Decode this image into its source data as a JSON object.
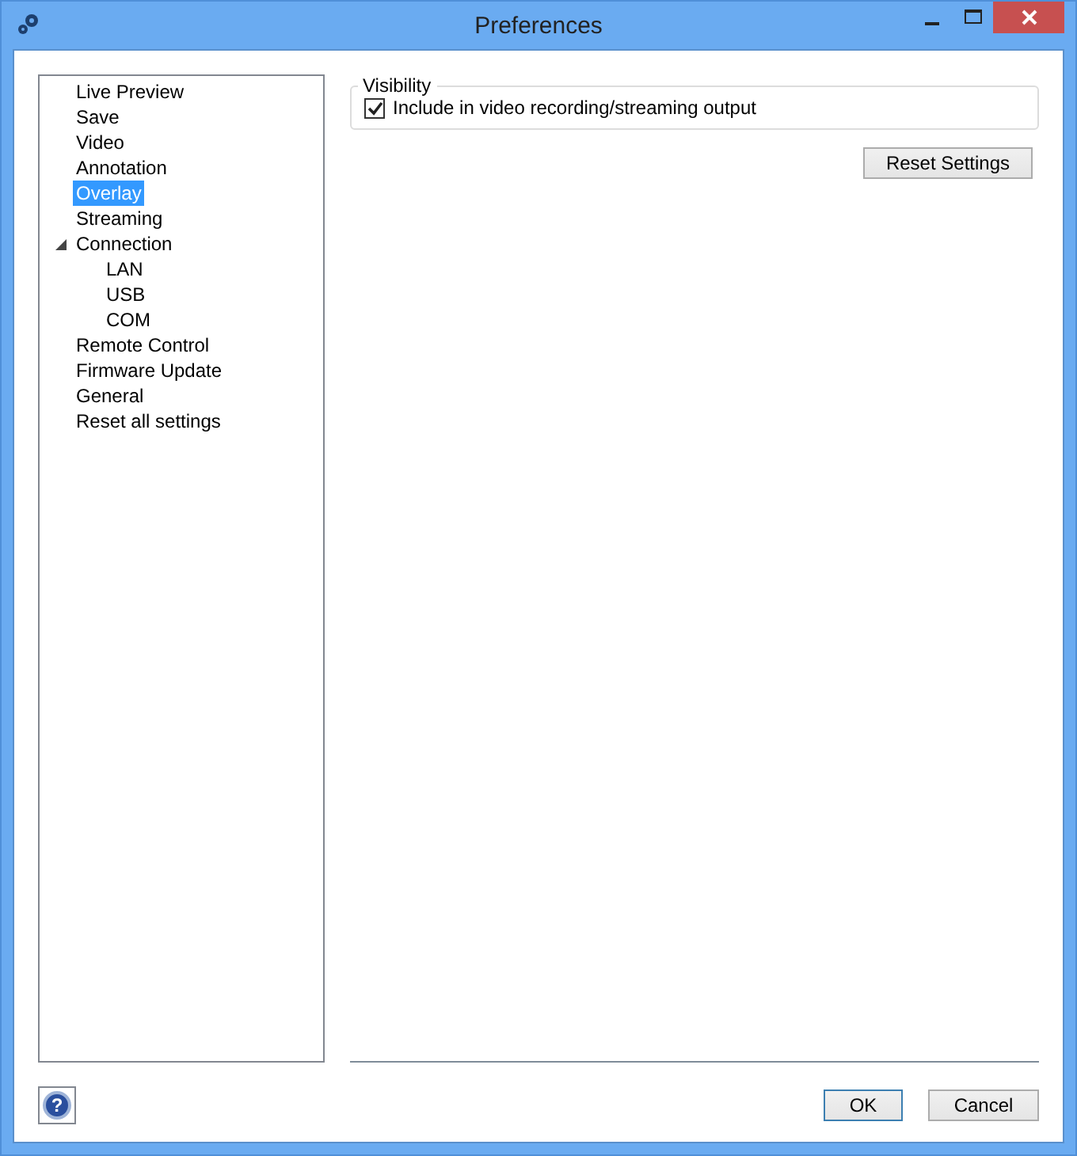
{
  "window": {
    "title": "Preferences"
  },
  "tree": [
    {
      "label": "Live Preview",
      "selected": false
    },
    {
      "label": "Save",
      "selected": false
    },
    {
      "label": "Video",
      "selected": false
    },
    {
      "label": "Annotation",
      "selected": false
    },
    {
      "label": "Overlay",
      "selected": true
    },
    {
      "label": "Streaming",
      "selected": false
    },
    {
      "label": "Connection",
      "selected": false,
      "expanded": true,
      "children": [
        {
          "label": "LAN",
          "selected": false
        },
        {
          "label": "USB",
          "selected": false
        },
        {
          "label": "COM",
          "selected": false
        }
      ]
    },
    {
      "label": "Remote Control",
      "selected": false
    },
    {
      "label": "Firmware Update",
      "selected": false
    },
    {
      "label": "General",
      "selected": false
    },
    {
      "label": "Reset all settings",
      "selected": false
    }
  ],
  "visibility": {
    "title": "Visibility",
    "option": {
      "label": "Include in video recording/streaming output",
      "checked": true
    }
  },
  "reset_button": "Reset Settings",
  "help_button": "?",
  "buttons": [
    {
      "label": "OK",
      "default": true
    },
    {
      "label": "Cancel",
      "default": false
    }
  ]
}
